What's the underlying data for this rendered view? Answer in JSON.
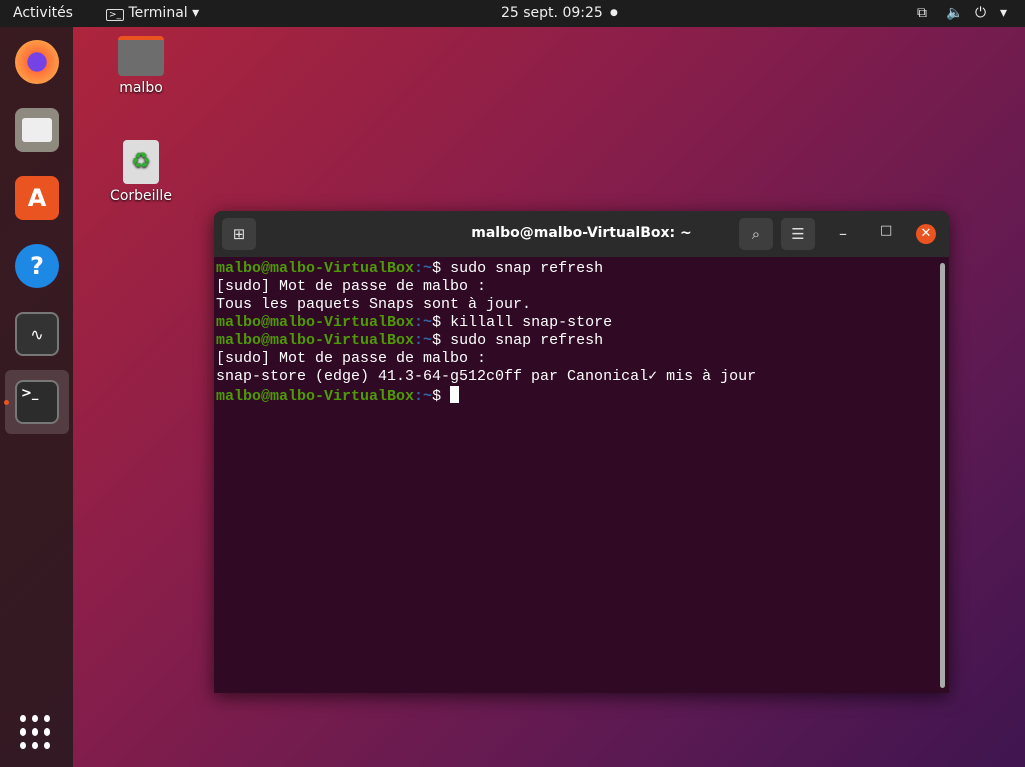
{
  "topbar": {
    "activities": "Activités",
    "app_menu": "Terminal",
    "clock": "25 sept.  09:25"
  },
  "dock": {
    "apps": [
      "Firefox",
      "Fichiers",
      "Ubuntu Software",
      "Aide",
      "Moniteur système",
      "Terminal"
    ]
  },
  "desktop": {
    "icons": [
      {
        "label": "malbo"
      },
      {
        "label": "Corbeille"
      }
    ]
  },
  "terminal": {
    "title": "malbo@malbo-VirtualBox: ~",
    "prompt_user": "malbo@malbo-VirtualBox",
    "prompt_path": ":~",
    "prompt_sign": "$ ",
    "lines": [
      {
        "type": "cmd",
        "text": "sudo snap refresh"
      },
      {
        "type": "out",
        "text": "[sudo] Mot de passe de malbo : "
      },
      {
        "type": "out",
        "text": "Tous les paquets Snaps sont à jour."
      },
      {
        "type": "cmd",
        "text": "killall snap-store"
      },
      {
        "type": "cmd",
        "text": "sudo snap refresh"
      },
      {
        "type": "out",
        "text": "[sudo] Mot de passe de malbo : "
      },
      {
        "type": "out",
        "text": "snap-store (edge) 41.3-64-g512c0ff par Canonical✓ mis à jour"
      }
    ]
  }
}
